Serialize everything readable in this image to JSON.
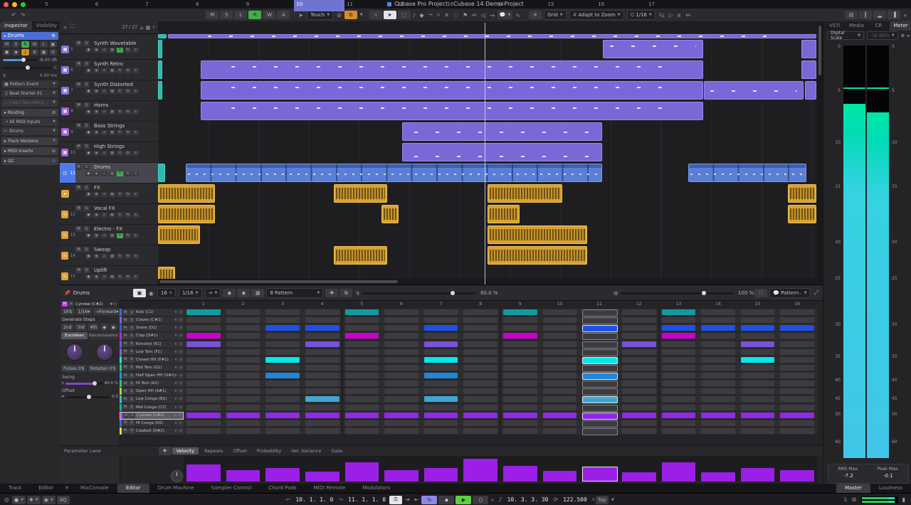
{
  "titlebar": {
    "title": "Cubase Pro Project - Cubase 14 Demo Project"
  },
  "toolbar": {
    "automation_buttons": [
      "M",
      "S",
      "L",
      "R",
      "W",
      "A"
    ],
    "automation_mode": "Touch",
    "snap_label": "Grid",
    "grid_label": "Adapt to Zoom",
    "quantize_label": "1/16"
  },
  "inspector": {
    "tabs": [
      "Inspector",
      "Visibility"
    ],
    "header": "Drums",
    "btn_row1": [
      "M",
      "S",
      "R",
      "W",
      "L",
      "▣"
    ],
    "btn_row2": [
      "●",
      "◉",
      "♪",
      "≣",
      "▣",
      "⊘"
    ],
    "volume": "-8.00 dB",
    "pan": "C",
    "delay": "0.00 ms",
    "pattern_event": "Pattern Event",
    "preset": "Beat Starter 01",
    "insert_rec": "Insert Recording...",
    "routing": "Routing",
    "input": "All MIDI Inputs",
    "output": "Drums",
    "track_versions": "Track Versions",
    "midi_inserts": "MIDI Inserts",
    "qc": "QC"
  },
  "arrange": {
    "counter": "27 / 27",
    "ruler_bars": [
      5,
      6,
      7,
      8,
      9,
      10,
      11,
      12,
      13,
      14,
      15,
      16,
      17
    ],
    "cycle": {
      "from": 10,
      "to": 11
    },
    "playhead_bar": 10.65,
    "tracks": [
      {
        "num": "5",
        "name": "Synth Wavetable",
        "color": "#8a70e0",
        "rec": true,
        "selected": false,
        "icon": "▦"
      },
      {
        "num": "6",
        "name": "Synth Retro",
        "color": "#8a70e0",
        "rec": false,
        "selected": false,
        "icon": "▦"
      },
      {
        "num": "7",
        "name": "Synth Distorted",
        "color": "#8a70e0",
        "rec": false,
        "selected": false,
        "icon": "▦"
      },
      {
        "num": "8",
        "name": "Horns",
        "color": "#a05fd8",
        "rec": false,
        "selected": false,
        "icon": "▦"
      },
      {
        "num": "9",
        "name": "Bass Strings",
        "color": "#a05fd8",
        "rec": false,
        "selected": false,
        "icon": "▦"
      },
      {
        "num": "10",
        "name": "High Strings",
        "color": "#a05fd8",
        "rec": false,
        "selected": false,
        "icon": "▦"
      },
      {
        "num": "11",
        "name": "Drums",
        "color": "#4f7ae8",
        "rec": true,
        "selected": true,
        "icon": "◫"
      },
      {
        "num": "",
        "name": "FX",
        "color": "#e0a23a",
        "rec": false,
        "selected": false,
        "icon": "▸"
      },
      {
        "num": "12",
        "name": "Vocal FX",
        "color": "#e0a23a",
        "rec": false,
        "selected": false,
        "icon": "∿"
      },
      {
        "num": "13",
        "name": "Electro - FX",
        "color": "#e0a23a",
        "rec": true,
        "selected": false,
        "icon": "∿"
      },
      {
        "num": "14",
        "name": "Swoop",
        "color": "#e0a23a",
        "rec": false,
        "selected": false,
        "icon": "∿"
      },
      {
        "num": "15",
        "name": "Uplift",
        "color": "#e0a23a",
        "rec": false,
        "selected": false,
        "icon": "∿"
      }
    ],
    "track_buttons": [
      "●",
      "◉",
      "e",
      "▦",
      "R",
      "W",
      "≡"
    ],
    "event_colors": {
      "midi": "#7b68d8",
      "pattern": "#5b7fd6",
      "audio": "#d9a133",
      "sliver": "#2fb8ae"
    },
    "events": [
      {
        "t": -1,
        "b0": 4.35,
        "b1": 17.25,
        "type": "midi"
      },
      {
        "t": -1,
        "b0": 4.15,
        "b1": 4.34,
        "type": "sliver"
      },
      {
        "t": 0,
        "b0": 4.15,
        "b1": 4.25,
        "type": "sliver"
      },
      {
        "t": 0,
        "b0": 13,
        "b1": 15,
        "type": "midi"
      },
      {
        "t": 0,
        "b0": 16.95,
        "b1": 17.25,
        "type": "midi"
      },
      {
        "t": 1,
        "b0": 4.15,
        "b1": 4.25,
        "type": "sliver"
      },
      {
        "t": 1,
        "b0": 5,
        "b1": 15,
        "type": "midi"
      },
      {
        "t": 1,
        "b0": 16.95,
        "b1": 17.25,
        "type": "midi"
      },
      {
        "t": 2,
        "b0": 4.15,
        "b1": 4.25,
        "type": "sliver"
      },
      {
        "t": 2,
        "b0": 5,
        "b1": 15,
        "type": "midi"
      },
      {
        "t": 2,
        "b0": 15,
        "b1": 17,
        "type": "midi"
      },
      {
        "t": 2,
        "b0": 17.02,
        "b1": 17.25,
        "type": "midi"
      },
      {
        "t": 3,
        "b0": 5,
        "b1": 15,
        "type": "midi"
      },
      {
        "t": 4,
        "b0": 9,
        "b1": 13,
        "type": "midi"
      },
      {
        "t": 5,
        "b0": 9,
        "b1": 13,
        "type": "midi"
      },
      {
        "t": 6,
        "b0": 4.15,
        "b1": 4.3,
        "type": "sliver"
      },
      {
        "t": 6,
        "b0": 4.7,
        "b1": 13,
        "type": "pattern"
      },
      {
        "t": 6,
        "b0": 14.7,
        "b1": 17.05,
        "type": "pattern"
      },
      {
        "t": 7,
        "b0": 4.15,
        "b1": 5.3,
        "type": "audio"
      },
      {
        "t": 7,
        "b0": 7.65,
        "b1": 8.72,
        "type": "audio"
      },
      {
        "t": 7,
        "b0": 10.7,
        "b1": 12.2,
        "type": "audio"
      },
      {
        "t": 7,
        "b0": 16.68,
        "b1": 17.25,
        "type": "audio"
      },
      {
        "t": 8,
        "b0": 4.15,
        "b1": 5.3,
        "type": "audio"
      },
      {
        "t": 8,
        "b0": 8.6,
        "b1": 8.95,
        "type": "audio"
      },
      {
        "t": 8,
        "b0": 10.7,
        "b1": 11.35,
        "type": "audio"
      },
      {
        "t": 8,
        "b0": 16.68,
        "b1": 17.25,
        "type": "audio"
      },
      {
        "t": 9,
        "b0": 4.15,
        "b1": 5.0,
        "type": "audio"
      },
      {
        "t": 9,
        "b0": 10.7,
        "b1": 12.7,
        "type": "audio"
      },
      {
        "t": 10,
        "b0": 7.65,
        "b1": 8.72,
        "type": "audio"
      },
      {
        "t": 10,
        "b0": 10.7,
        "b1": 12.7,
        "type": "audio"
      },
      {
        "t": 11,
        "b0": 4.15,
        "b1": 4.5,
        "type": "audio"
      }
    ]
  },
  "editor": {
    "track": "Drums",
    "steps_value": "16",
    "grid_res": "1/16",
    "direction": "Forward",
    "pattern_slot": "8 Pattern",
    "swing_pct": "80.0 %",
    "zoom_pct": "100 %",
    "pattern_mode": "Pattern",
    "selected_lane": "Cymbal (C#2)",
    "generate_steps": "Generate Steps",
    "gen_buttons": [
      "2nd",
      "3rd",
      "4th"
    ],
    "gen_tabs": [
      "Euclidean",
      "Randomization"
    ],
    "pulses_label": "Pulses",
    "pulses": "0",
    "rotation_label": "Rotation",
    "rotation": "0",
    "swing_label": "Swing",
    "offset_label": "Offset",
    "offset_val": "0.0",
    "param_lane_label": "Parameter Lane",
    "param_tabs": [
      "Velocity",
      "Repeats",
      "Offset",
      "Probability",
      "Vel. Variance",
      "Gate"
    ],
    "playhead_step": 11,
    "lanes": [
      {
        "name": "Kick (C1)",
        "strip": "#3f66d9",
        "cell": "#129aa2",
        "steps": [
          1,
          5,
          9,
          13
        ]
      },
      {
        "name": "Claves (C#1)",
        "strip": "#8a5fe0",
        "cell": "#8a5fe0",
        "steps": []
      },
      {
        "name": "Snare (D1)",
        "strip": "#2f5fe0",
        "cell": "#1f50e8",
        "steps": [
          3,
          4,
          7,
          11,
          13,
          14,
          15,
          16
        ]
      },
      {
        "name": "Clap (D#1)",
        "strip": "#cc22cc",
        "cell": "#cc00cc",
        "steps": [
          1,
          5,
          9,
          13
        ]
      },
      {
        "name": "Rimshot (E1)",
        "strip": "#7a55d8",
        "cell": "#7852d8",
        "steps": [
          1,
          4,
          7,
          12,
          15
        ]
      },
      {
        "name": "Low Tom (F1)",
        "strip": "#8a5fe0",
        "cell": "#8a5fe0",
        "steps": []
      },
      {
        "name": "Closed HH (F#1)",
        "strip": "#22d8e8",
        "cell": "#00eaea",
        "steps": [
          3,
          7,
          11,
          15
        ]
      },
      {
        "name": "Mid Tom (G1)",
        "strip": "#33cc66",
        "cell": "#33cc66",
        "steps": []
      },
      {
        "name": "Half Open HH (G#1)",
        "strip": "#2f8fd8",
        "cell": "#1f86d8",
        "steps": [
          3,
          7,
          11
        ]
      },
      {
        "name": "Hi Tom (A1)",
        "strip": "#33cc66",
        "cell": "#33cc66",
        "steps": []
      },
      {
        "name": "Open HH (A#1)",
        "strip": "#a8d83a",
        "cell": "#a8d83a",
        "steps": []
      },
      {
        "name": "Low Conga (B1)",
        "strip": "#3fb8d8",
        "cell": "#3fa8d0",
        "steps": [
          4,
          7,
          11
        ]
      },
      {
        "name": "Mid Conga (C2)",
        "strip": "#2aa88a",
        "cell": "#2aa88a",
        "steps": []
      },
      {
        "name": "Cymbal (C#2)",
        "strip": "#c040e8",
        "cell": "#9228e8",
        "steps": [
          1,
          2,
          3,
          4,
          5,
          6,
          7,
          8,
          9,
          10,
          11,
          12,
          13,
          14,
          15,
          16
        ],
        "selected": true
      },
      {
        "name": "Hi Conga (D2)",
        "strip": "#3f66d9",
        "cell": "#3f66d9",
        "steps": []
      },
      {
        "name": "Cowbell (D#2)",
        "strip": "#e8d83a",
        "cell": "#e8d83a",
        "steps": []
      }
    ],
    "velocity": [
      72,
      48,
      55,
      40,
      80,
      48,
      55,
      95,
      65,
      44,
      55,
      38,
      80,
      38,
      55,
      48
    ]
  },
  "meter": {
    "tabs": [
      "VSTi",
      "Media",
      "CR",
      "Meter"
    ],
    "active_tab": "Meter",
    "scale": "Digital Scale",
    "ref": "-18 dBFS",
    "ticks": [
      {
        "label": "0",
        "pos": 0
      },
      {
        "label": "5",
        "pos": 11
      },
      {
        "label": "10",
        "pos": 24
      },
      {
        "label": "15",
        "pos": 35
      },
      {
        "label": "20",
        "pos": 49
      },
      {
        "label": "25",
        "pos": 58
      },
      {
        "label": "30",
        "pos": 69.5
      },
      {
        "label": "35",
        "pos": 77.5
      },
      {
        "label": "40",
        "pos": 83.5
      },
      {
        "label": "45",
        "pos": 88
      },
      {
        "label": "50",
        "pos": 92
      },
      {
        "label": "60",
        "pos": 99
      }
    ],
    "channels": [
      {
        "lit_from": 14.2
      },
      {
        "lit_from": 16.2
      }
    ],
    "peak_line": 10.2,
    "rms_label": "RMS Max.",
    "rms": "-7.2",
    "peak_label": "Peak Max.",
    "peak": "-0.1",
    "bottom_tabs": [
      "Master",
      "Loudness"
    ]
  },
  "bottom_tabs": {
    "left": [
      "Track",
      "Editor",
      "MixConsole",
      "Editor",
      "Drum Machine",
      "Sampler Control",
      "Chord Pads",
      "MIDI Remote",
      "Modulators"
    ],
    "active_index": 3
  },
  "transport": {
    "left_locator": "10. 1. 1.  0",
    "right_locator": "11. 1. 1.  0",
    "position": "10. 3. 3. 30",
    "tempo": "122.500",
    "tap": "Tap",
    "aq": "AQ"
  }
}
